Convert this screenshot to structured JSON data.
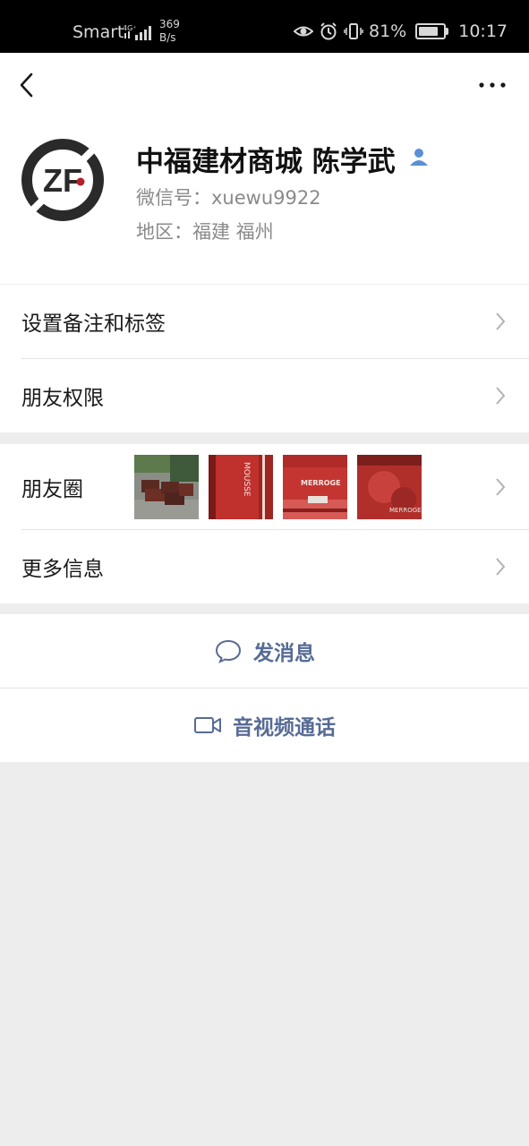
{
  "status_bar": {
    "carrier": "Smart",
    "network": "4G⁺",
    "speed_value": "369",
    "speed_unit": "B/s",
    "battery": "81%",
    "battery_level": 0.81,
    "time": "10:17"
  },
  "profile": {
    "avatar_text": "ZF",
    "name": "中福建材商城 陈学武",
    "wechat_id": "微信号：xuewu9922",
    "region": "地区：福建  福州"
  },
  "menu": {
    "remark_label": "设置备注和标签",
    "permissions_label": "朋友权限",
    "moments_label": "朋友圈",
    "more_info_label": "更多信息"
  },
  "moments_thumbs": [
    {
      "kind": "photo-crates"
    },
    {
      "kind": "photo-red-panel"
    },
    {
      "kind": "photo-red-label"
    },
    {
      "kind": "photo-red-surface"
    }
  ],
  "thumb_text": {
    "t2": "MOUSSE",
    "t3": "MERROGE",
    "t4": "MERROGE"
  },
  "actions": {
    "message_label": "发消息",
    "call_label": "音视频通话"
  },
  "colors": {
    "accent": "#576b95",
    "background": "#ededed",
    "icon_blue": "#5b8fd6"
  }
}
